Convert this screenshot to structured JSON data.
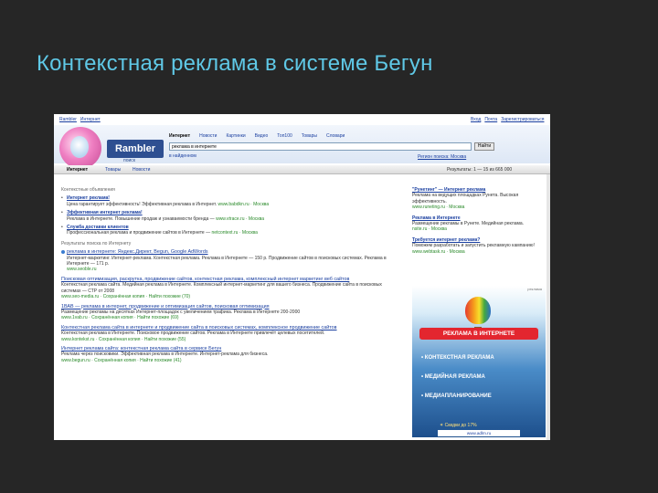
{
  "slide_title": "Контекстная реклама в системе Бегун",
  "browser": {
    "top_left_links": [
      "Rambler",
      "Интернет"
    ],
    "top_right_links": [
      "Вход",
      "Почта",
      "Зарегистрироваться"
    ]
  },
  "header": {
    "logo": "Rambler",
    "logo_sub": "поиск",
    "nav_tabs": [
      "Интернет",
      "Новости",
      "Картинки",
      "Видео",
      "Топ100",
      "Товары",
      "Словари"
    ],
    "search_value": "реклама в интернете",
    "search_button": "Найти",
    "region": "в найденном",
    "right_link": "Регион поиска: Москва"
  },
  "result_tabs": {
    "items": [
      "Интернет",
      "Товары",
      "Новости"
    ],
    "results_count": "Результаты: 1 — 15 из 665 000"
  },
  "context_ads": {
    "section_label": "Контекстные объявления",
    "ads": [
      {
        "title": "Интернет реклама!",
        "snippet": "Цена гарантирует эффективность! Эффективная реклама в Интернет.",
        "url": "www.babdkn.ru · Москва"
      },
      {
        "title": "Эффективная интернет реклама!",
        "snippet": "Реклама в Интернете. Повышение продаж и узнаваемости бренда —",
        "url": "www.vtrace.ru · Москва"
      },
      {
        "title": "Служба доставки клиентов",
        "snippet": "Профессиональная реклама и продвижение сайтов в Интернете —",
        "url": "netcontext.ru · Москва"
      }
    ]
  },
  "results": {
    "section_label": "Результаты поиска по Интернету",
    "items": [
      {
        "title": "реклама в интернете: Яндекс.Директ, Begun, Google AdWords",
        "snippet": "Интернет-маркетинг. Интернет-реклама. Контекстная реклама. Реклама в Интернете — 150 р. Продвижение сайтов в поисковых системах. Реклама в Интернете — 171 р.",
        "url": "www.seoble.ru"
      },
      {
        "title": "Поисковая оптимизация, раскрутка, продвижение сайтов, контекстная реклама, комплексный интернет маркетинг веб сайтов",
        "snippet": "Контекстная реклама сайта. Медийная реклама в Интернете. Комплексный интернет-маркетинг для вашего бизнеса. Продвижение сайта в поисковых системах — СТР от 2008",
        "url": "www.seo-media.ru · Сохранённая копия · Найти похожие (70)"
      },
      {
        "title": "1ВАВ — реклама в интернет, продвижение и оптимизация сайтов, поисковая оптимизация",
        "snippet": "Размещение рекламы на десятках Интернет-площадок с увеличением трафика. Реклама в Интернете 200-2000",
        "url": "www.1vab.ru · Сохранённая копия · Найти похожие (69)"
      },
      {
        "title": "Контекстная реклама сайта в интернете и продвижение сайта в поисковых системах, комплексное продвижение сайтов",
        "snippet": "Контекстная реклама в Интернете. Поисковое продвижение сайтов. Реклама в Интернете привлечёт целевых посетителей.",
        "url": "www.kontekst.ru · Сохранённая копия · Найти похожие (55)"
      },
      {
        "title": "Интернет реклама сайта: контекстная реклама сайта в сервисе Бегун",
        "snippet": "Реклама через поисковики. Эффективная реклама в Интернете. Интернет-реклама для бизнеса.",
        "url": "www.begun.ru · Сохранённая копия · Найти похожие (41)"
      }
    ]
  },
  "right_ads": [
    {
      "title": "\"Рунетинг\" — Интернет реклама",
      "snippet": "Реклама на ведущих площадках Рунета. Высокая эффективность.",
      "url": "www.runeting.ru · Москва"
    },
    {
      "title": "Реклама в Интернете",
      "snippet": "Размещение рекламы в Рунете. Медийная реклама.",
      "url": "nsite.ru · Москва"
    },
    {
      "title": "Требуется интернет реклама?",
      "snippet": "Поможем разработать и запустить рекламную кампанию!",
      "url": "www.webtask.ru · Москва"
    }
  ],
  "banner": {
    "ad_label": "реклама",
    "headline": "РЕКЛАМА В ИНТЕРНЕТЕ",
    "items": [
      "КОНТЕКСТНАЯ РЕКЛАМА",
      "МЕДИЙНАЯ РЕКЛАМА",
      "МЕДИАПЛАНИРОВАНИЕ"
    ],
    "discount": "Скидки до 17%",
    "site": "www.adlm.ru"
  }
}
